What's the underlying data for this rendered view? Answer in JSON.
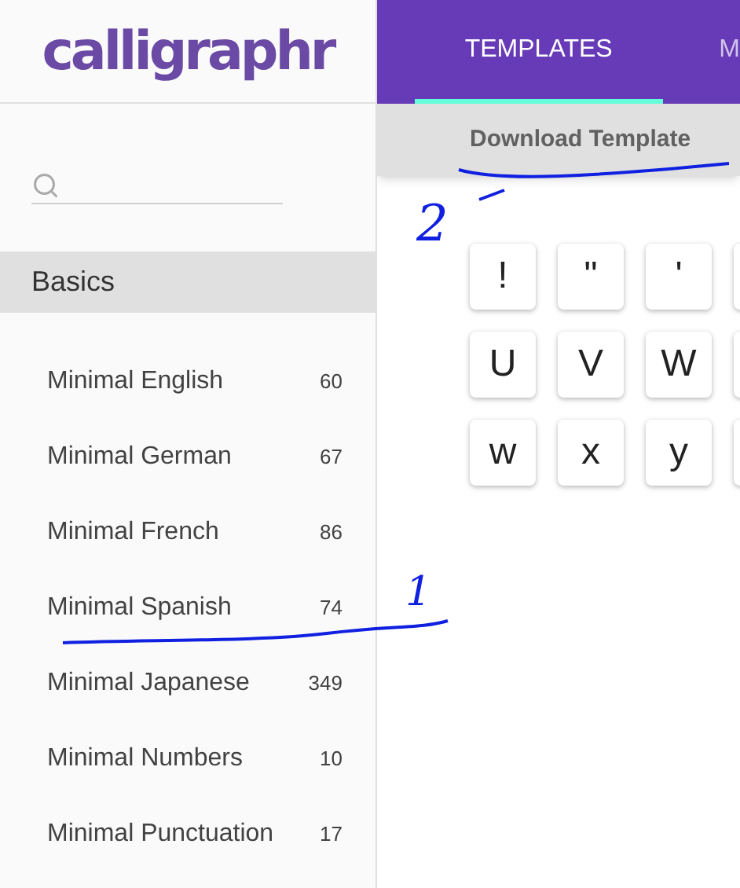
{
  "logo": "calligraphr",
  "tabs": [
    {
      "label": "TEMPLATES",
      "selected": true
    },
    {
      "label": "M",
      "selected": false
    }
  ],
  "toolbar": {
    "button": "Download Template"
  },
  "sidebar": {
    "section": "Basics",
    "items": [
      {
        "name": "Minimal English",
        "count": "60"
      },
      {
        "name": "Minimal German",
        "count": "67"
      },
      {
        "name": "Minimal French",
        "count": "86"
      },
      {
        "name": "Minimal Spanish",
        "count": "74"
      },
      {
        "name": "Minimal Japanese",
        "count": "349"
      },
      {
        "name": "Minimal Numbers",
        "count": "10"
      },
      {
        "name": "Minimal Punctuation",
        "count": "17"
      }
    ]
  },
  "characters": [
    [
      "!",
      "\"",
      "'"
    ],
    [
      "U",
      "V",
      "W"
    ],
    [
      "w",
      "x",
      "y"
    ]
  ],
  "annotations": [
    {
      "label": "2"
    },
    {
      "label": "1"
    }
  ]
}
